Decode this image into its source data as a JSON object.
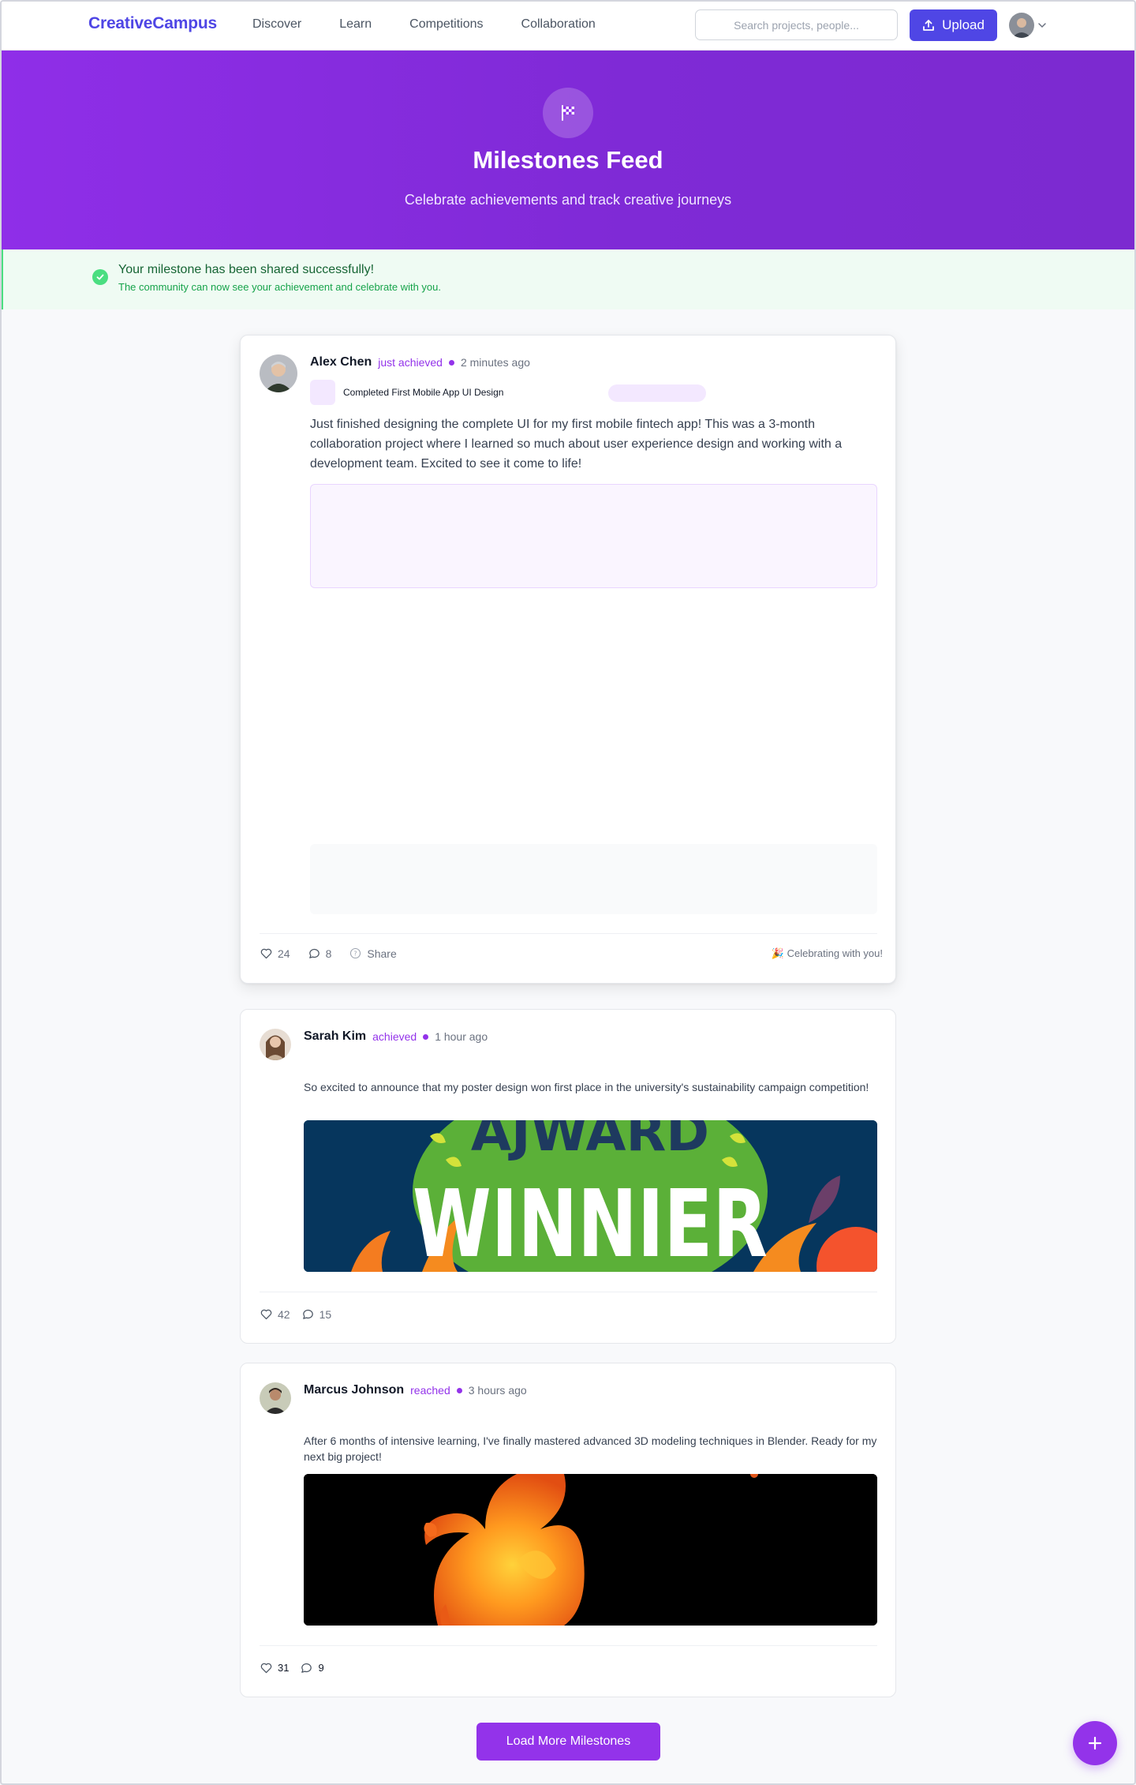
{
  "nav": {
    "brand": "CreativeCampus",
    "links": [
      "Discover",
      "Learn",
      "Competitions",
      "Collaboration"
    ],
    "search_placeholder": "Search projects, people...",
    "upload_label": "Upload"
  },
  "hero": {
    "icon": "checkered-flag-icon",
    "title": "Milestones Feed",
    "subtitle": "Celebrate achievements and track creative journeys"
  },
  "success": {
    "title": "Your milestone has been shared successfully!",
    "message": "The community can now see your achievement and celebrate with you."
  },
  "posts": [
    {
      "author": "Alex Chen",
      "verb": "just achieved",
      "time": "2 minutes ago",
      "milestone": "Completed First Mobile App UI Design",
      "text": "Just finished designing the complete UI for my first mobile fintech app! This was a 3-month collaboration project where I learned so much about user experience design and working with a development team. Excited to see it come to life!",
      "likes": "24",
      "comments": "8",
      "share_label": "Share",
      "celebrate": "🎉 Celebrating with you!"
    },
    {
      "author": "Sarah Kim",
      "verb": "achieved",
      "time": "1 hour ago",
      "text": "So excited to announce that my poster design won first place in the university's sustainability campaign competition!",
      "image_text_top": "AJWARD",
      "image_text_main": "WINNIER",
      "likes": "42",
      "comments": "15"
    },
    {
      "author": "Marcus Johnson",
      "verb": "reached",
      "time": "3 hours ago",
      "text": "After 6 months of intensive learning, I've finally mastered advanced 3D modeling techniques in Blender. Ready for my next big project!",
      "likes": "31",
      "comments": "9"
    }
  ],
  "load_more_label": "Load More Milestones",
  "colors": {
    "brand": "#4f46e5",
    "accent": "#9333ea",
    "hero_gradient_start": "#8f2ee8",
    "hero_gradient_end": "#7c2ad0",
    "success_bg": "#effbf3",
    "success_text": "#166534"
  }
}
